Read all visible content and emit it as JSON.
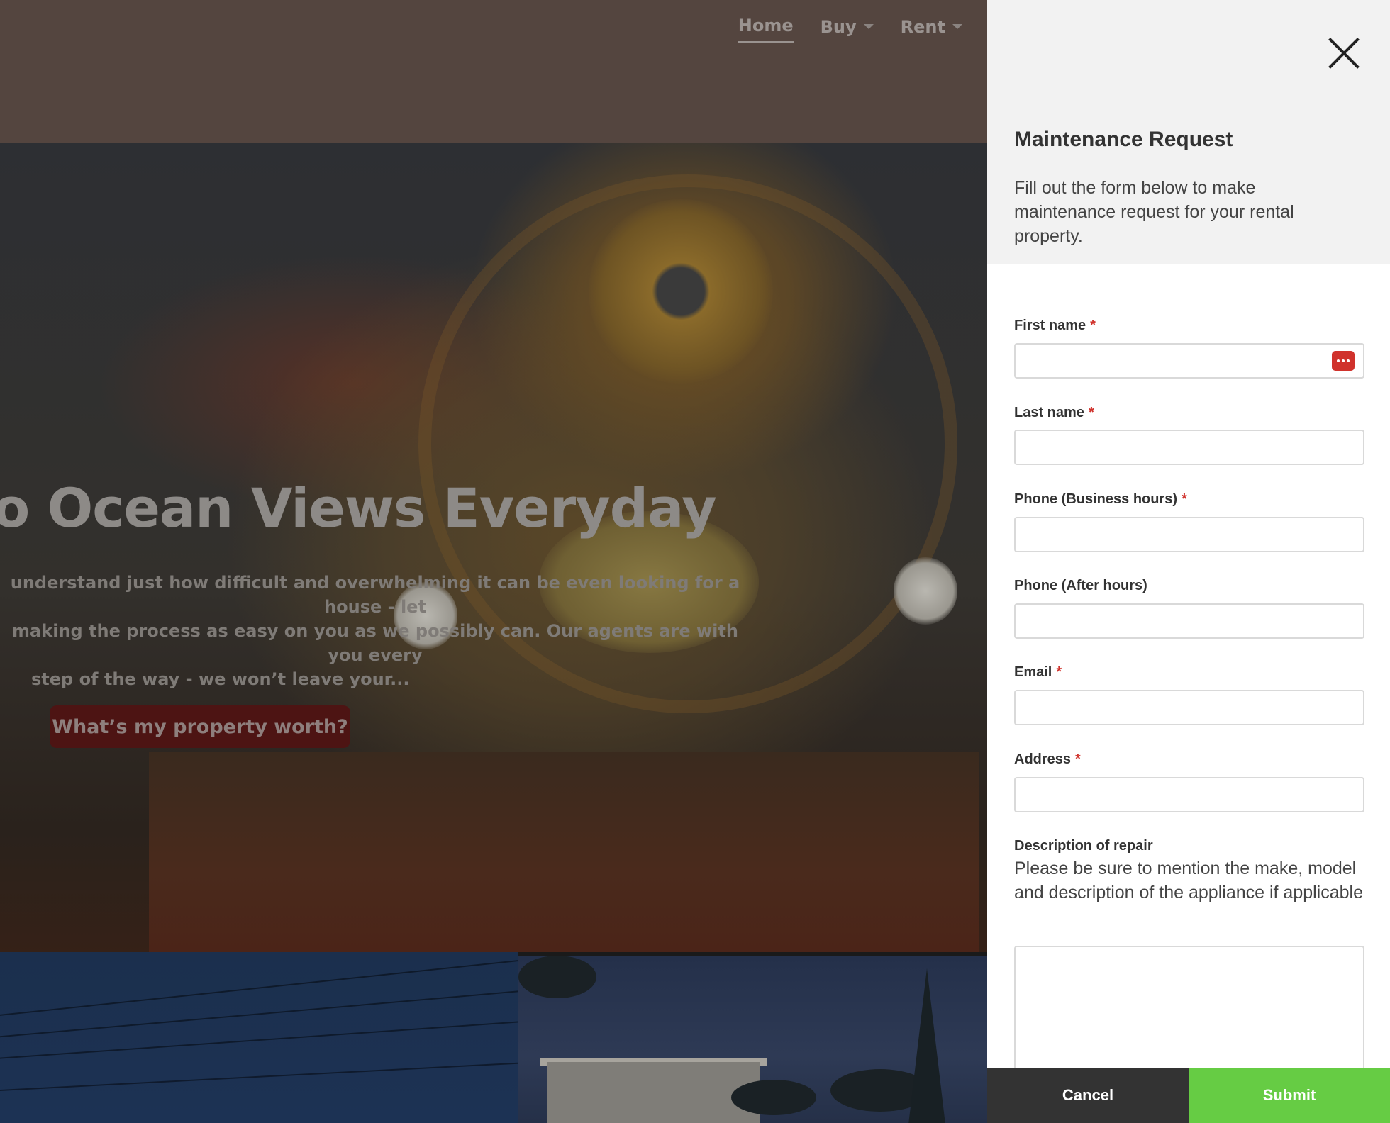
{
  "nav": {
    "items": [
      {
        "label": "Home",
        "active": true,
        "has_dropdown": false
      },
      {
        "label": "Buy",
        "active": false,
        "has_dropdown": true
      },
      {
        "label": "Rent",
        "active": false,
        "has_dropdown": true
      }
    ]
  },
  "hero": {
    "title": "o Ocean Views Everyday",
    "text_lines": [
      "understand just how difficult and overwhelming it can be even looking for a house - let",
      "making the process as easy on you as we possibly can. Our agents are with you every",
      "step of the way - we won’t leave your..."
    ],
    "cta_label": "What’s my property worth?"
  },
  "drawer": {
    "title": "Maintenance Request",
    "subtitle": "Fill out the form below to make maintenance request for your rental property.",
    "fields": {
      "first_name": {
        "label": "First name",
        "required_mark": "*",
        "value": ""
      },
      "last_name": {
        "label": "Last name",
        "required_mark": "*",
        "value": ""
      },
      "phone_business": {
        "label": "Phone (Business hours)",
        "required_mark": "*",
        "value": ""
      },
      "phone_after": {
        "label": "Phone (After hours)",
        "value": ""
      },
      "email": {
        "label": "Email",
        "required_mark": "*",
        "value": ""
      },
      "address": {
        "label": "Address",
        "required_mark": "*",
        "value": ""
      },
      "description": {
        "label": "Description of repair",
        "help": "Please be sure to mention the make, model and description of the appliance if applicable",
        "value": ""
      }
    },
    "cancel_label": "Cancel",
    "submit_label": "Submit"
  },
  "icons": {
    "close": "close-icon",
    "password_manager": "password-manager-icon",
    "dropdown": "chevron-down-icon"
  },
  "colors": {
    "accent_submit": "#66cc44",
    "cancel_bg": "#333333",
    "required": "#d0322c",
    "cta_bg": "#4d1413"
  }
}
